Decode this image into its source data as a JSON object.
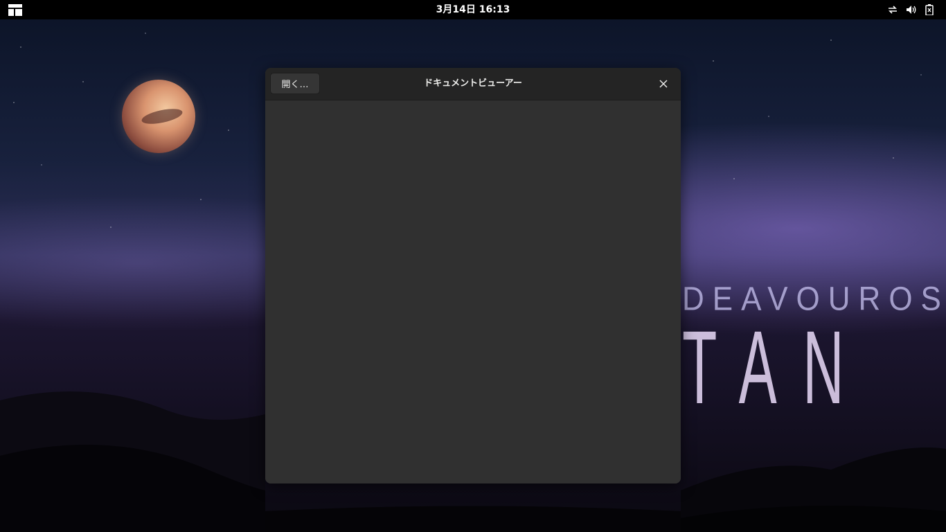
{
  "topbar": {
    "clock": "3月14日  16:13",
    "activities_icon": "activities-grid-icon",
    "tray_icons": [
      "network-sync-icon",
      "volume-icon",
      "battery-icon"
    ]
  },
  "wallpaper": {
    "brand_small": "DEAVOUROS",
    "brand_big": "TAN"
  },
  "window": {
    "title": "ドキュメントビューアー",
    "open_button_label": "開く…",
    "close_icon": "close-icon",
    "background": "#303030",
    "header_background": "#242424"
  }
}
